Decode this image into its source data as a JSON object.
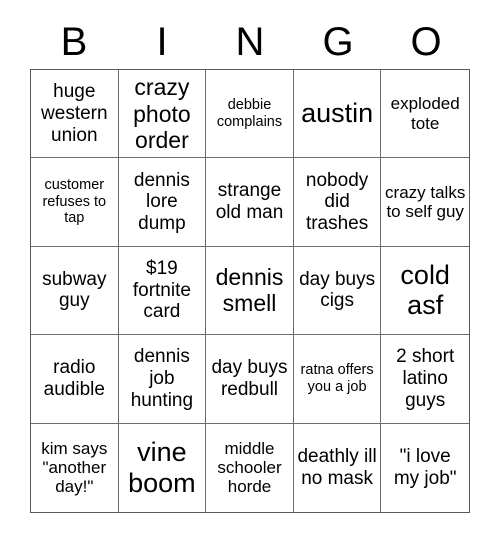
{
  "card": {
    "title_letters": [
      "B",
      "I",
      "N",
      "G",
      "O"
    ],
    "columns": 5,
    "rows": 5,
    "colors": {
      "background": "#ffffff",
      "text": "#000000",
      "inner_grid_line": "#6d6e71",
      "outer_border": "#58595b"
    },
    "cells": [
      {
        "text": "huge western union",
        "size": "md"
      },
      {
        "text": "crazy photo order",
        "size": "lg"
      },
      {
        "text": "debbie complains",
        "size": "xs"
      },
      {
        "text": "austin",
        "size": "xl"
      },
      {
        "text": "exploded tote",
        "size": "sm"
      },
      {
        "text": "customer refuses to tap",
        "size": "xs"
      },
      {
        "text": "dennis lore dump",
        "size": "md"
      },
      {
        "text": "strange old man",
        "size": "md"
      },
      {
        "text": "nobody did trashes",
        "size": "md"
      },
      {
        "text": "crazy talks to self guy",
        "size": "sm"
      },
      {
        "text": "subway guy",
        "size": "md"
      },
      {
        "text": "$19 fortnite card",
        "size": "md"
      },
      {
        "text": "dennis smell",
        "size": "lg"
      },
      {
        "text": "day buys cigs",
        "size": "md"
      },
      {
        "text": "cold asf",
        "size": "xl"
      },
      {
        "text": "radio audible",
        "size": "md"
      },
      {
        "text": "dennis job hunting",
        "size": "md"
      },
      {
        "text": "day buys redbull",
        "size": "md"
      },
      {
        "text": "ratna offers you a job",
        "size": "xs"
      },
      {
        "text": "2 short latino guys",
        "size": "md"
      },
      {
        "text": "kim says \"another day!\"",
        "size": "sm"
      },
      {
        "text": "vine boom",
        "size": "xl"
      },
      {
        "text": "middle schooler horde",
        "size": "sm"
      },
      {
        "text": "deathly ill no mask",
        "size": "md"
      },
      {
        "text": "\"i love my job\"",
        "size": "md"
      }
    ]
  }
}
